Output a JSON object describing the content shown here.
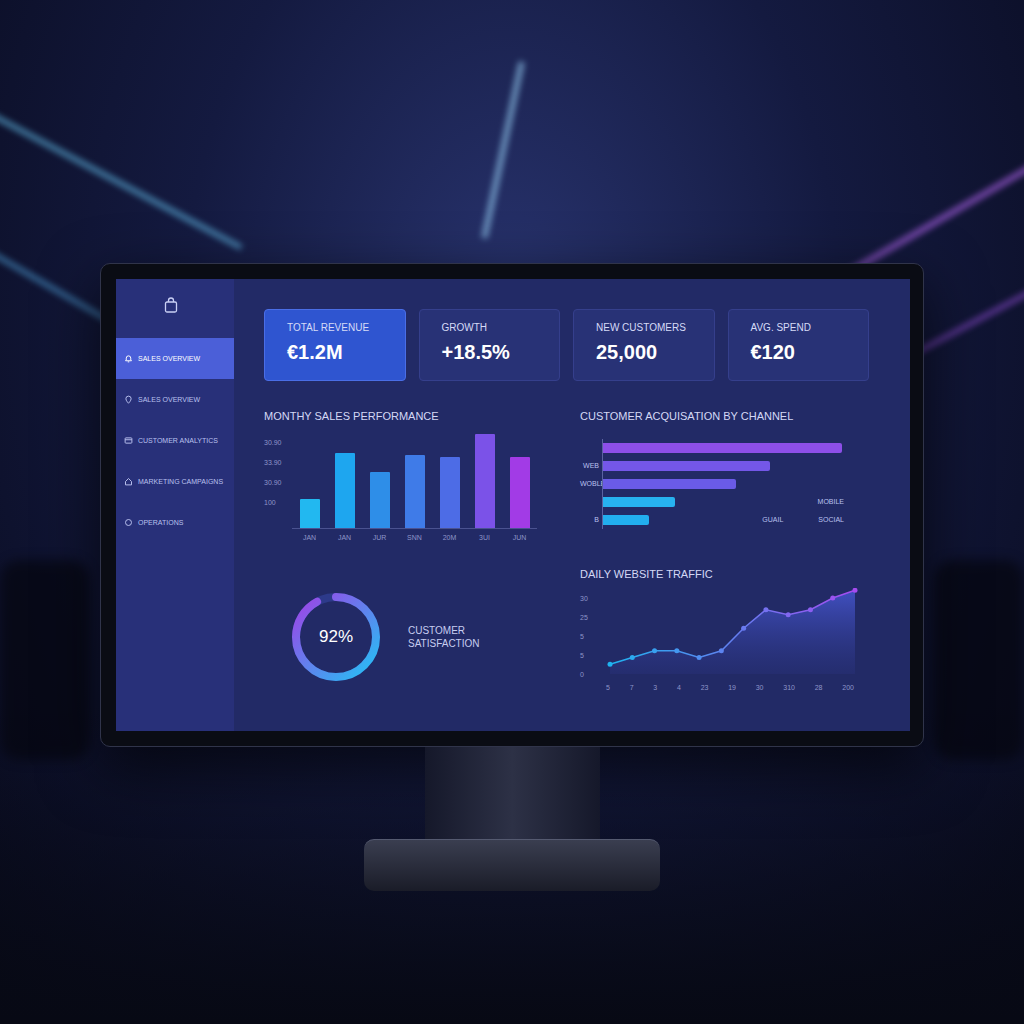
{
  "sidebar": {
    "items": [
      {
        "label": "SALES OVERVIEW",
        "selected": true
      },
      {
        "label": "SALES OVERVIEW",
        "selected": false
      },
      {
        "label": "CUSTOMER ANALYTICS",
        "selected": false
      },
      {
        "label": "MARKETING CAMPAIGNS",
        "selected": false
      },
      {
        "label": "OPERATIONS",
        "selected": false
      }
    ]
  },
  "kpis": [
    {
      "label": "TOTAL REVENUE",
      "value": "€1.2M",
      "highlighted": true
    },
    {
      "label": "GROWTH",
      "value": "+18.5%",
      "highlighted": false
    },
    {
      "label": "NEW CUSTOMERS",
      "value": "25,000",
      "highlighted": false
    },
    {
      "label": "AVG. SPEND",
      "value": "€120",
      "highlighted": false
    }
  ],
  "sales_chart": {
    "title": "MONTHY SALES PERFORMANCE",
    "y_ticks": [
      "30.90",
      "33.90",
      "30.90",
      "100"
    ],
    "bars": [
      {
        "label": "JAN",
        "value": 30,
        "color": "#22b8f0"
      },
      {
        "label": "JAN",
        "value": 77,
        "color": "#1ea6ef"
      },
      {
        "label": "JUR",
        "value": 58,
        "color": "#2e8ee8"
      },
      {
        "label": "SNN",
        "value": 75,
        "color": "#3f7be8"
      },
      {
        "label": "20M",
        "value": 73,
        "color": "#4d6ce6"
      },
      {
        "label": "3UI",
        "value": 97,
        "color": "#7b52e8"
      },
      {
        "label": "JUN",
        "value": 73,
        "color": "#a23be6"
      }
    ]
  },
  "acquisition_chart": {
    "title": "CUSTOMER ACQUISATION BY CHANNEL",
    "bars": [
      {
        "value": 240,
        "color": "#8d4fe8",
        "notes": []
      },
      {
        "label": "WEB",
        "value": 168,
        "color": "#7457e8",
        "notes": []
      },
      {
        "label": "WOBLE",
        "value": 134,
        "color": "#6a5be7",
        "notes": []
      },
      {
        "value": 72,
        "color": "#27b2f0",
        "notes": [
          "MOBILE"
        ]
      },
      {
        "label": "B",
        "value": 46,
        "color": "#22aeee",
        "notes": [
          "GUAIL",
          "SOCIAL"
        ]
      }
    ]
  },
  "satisfaction": {
    "value": "92%",
    "label": "CUSTOMER SATISFACTION",
    "level": 0.92
  },
  "traffic_chart": {
    "title": "DAILY WEBSITE TRAFFIC",
    "y_ticks": [
      "30",
      "25",
      "5",
      "5",
      "0"
    ],
    "x_labels": [
      "5",
      "7",
      "3",
      "4",
      "23",
      "19",
      "30",
      "310",
      "28",
      "200"
    ],
    "values": [
      3.9,
      6.6,
      9.3,
      9.3,
      6.6,
      9.3,
      18.3,
      25.7,
      23.7,
      25.7,
      30.4,
      33.5
    ]
  }
}
